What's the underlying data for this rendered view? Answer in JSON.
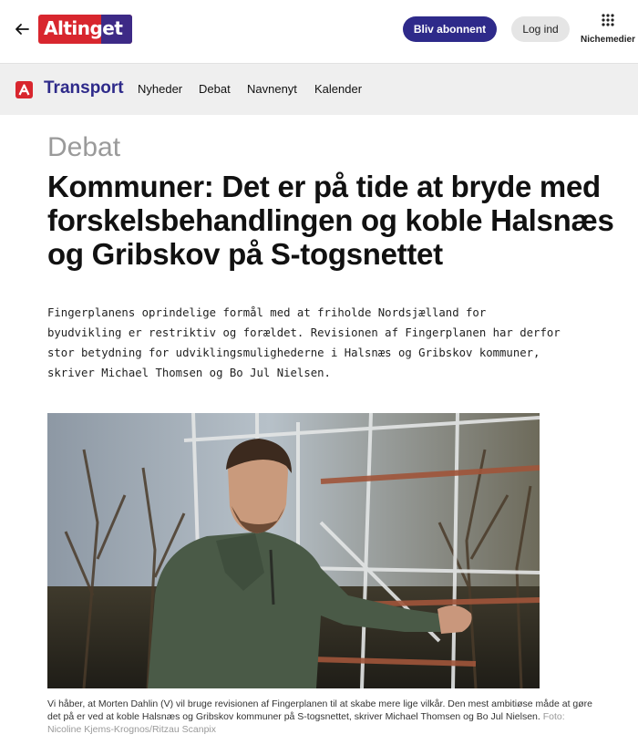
{
  "header": {
    "logo_text": "Altinget",
    "subscribe_label": "Bliv abonnent",
    "login_label": "Log ind",
    "niche_label": "Nichemedier"
  },
  "section": {
    "title": "Transport",
    "nav": [
      "Nyheder",
      "Debat",
      "Navnenyt",
      "Kalender"
    ]
  },
  "article": {
    "kicker": "Debat",
    "headline": "Kommuner: Det er på tide at bryde med forskelsbehandlingen og koble Halsnæs og Gribskov på S-togsnettet",
    "lede": "Fingerplanens oprindelige formål med at friholde Nordsjælland for byudvikling er restriktiv og forældet. Revisionen af Fingerplanen har derfor stor betydning for udviklingsmulighederne i Halsnæs og Gribskov kommuner, skriver Michael Thomsen og Bo Jul Nielsen.",
    "caption": "Vi håber, at Morten Dahlin (V) vil bruge revisionen af Fingerplanen til at skabe mere lige vilkår. Den mest ambitiøse måde at gøre det på er ved at koble Halsnæs og Gribskov kommuner på S-togsnettet, skriver Michael Thomsen og Bo Jul Nielsen.",
    "photo_credit": "Foto: Nicoline Kjems-Krognos/Ritzau Scanpix"
  },
  "colors": {
    "brand_red": "#d8262e",
    "brand_purple": "#2e2a8a",
    "section_bg": "#efefef",
    "kicker_grey": "#9a9a9a"
  },
  "icons": [
    "back-arrow-icon",
    "grid-dots-icon",
    "section-logo-icon"
  ]
}
